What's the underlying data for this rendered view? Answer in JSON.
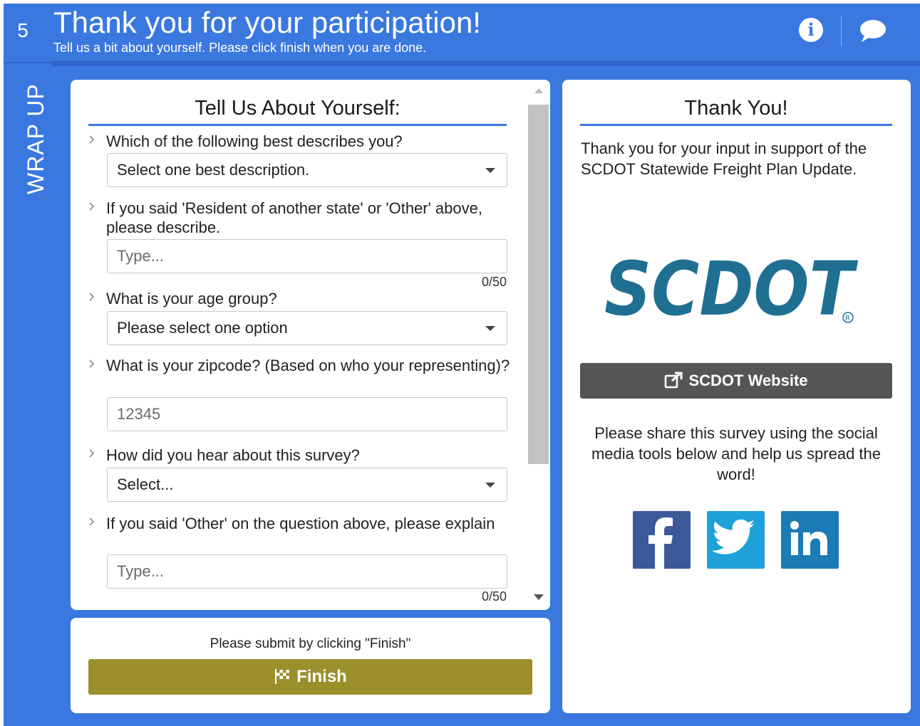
{
  "sidebar": {
    "step_number": "5",
    "section_label": "WRAP UP"
  },
  "header": {
    "title": "Thank you for your participation!",
    "subtitle": "Tell us a bit about yourself. Please click finish when you are done.",
    "info_icon": "info-icon",
    "chat_icon": "chat-bubble-icon"
  },
  "form": {
    "title": "Tell Us About Yourself:",
    "questions": [
      {
        "label": "Which of the following best describes you?",
        "type": "select",
        "value": "Select one best description."
      },
      {
        "label": "If you said 'Resident of another state' or 'Other' above, please describe.",
        "type": "text",
        "placeholder": "Type...",
        "counter": "0/50"
      },
      {
        "label": "What is your age group?",
        "type": "select",
        "value": "Please select one option"
      },
      {
        "label": "What is your zipcode? (Based on who your representing)?",
        "type": "text",
        "placeholder": "12345"
      },
      {
        "label": "How did you hear about this survey?",
        "type": "select",
        "value": "Select..."
      },
      {
        "label": "If you said 'Other' on the question above, please explain",
        "type": "text",
        "placeholder": "Type...",
        "counter": "0/50"
      }
    ]
  },
  "submit": {
    "note": "Please submit by clicking \"Finish\"",
    "finish_label": "Finish"
  },
  "thanks": {
    "title": "Thank You!",
    "message": "Thank you for your input in support of the SCDOT Statewide Freight Plan Update.",
    "logo_text": "SCDOT",
    "website_label": "SCDOT Website",
    "share_text": "Please share this survey using the social media tools below and help us spread the word!",
    "social": [
      "facebook-icon",
      "twitter-icon",
      "linkedin-icon"
    ]
  },
  "colors": {
    "brand_blue": "#3a78e0",
    "finish_olive": "#9a8f2b",
    "website_gray": "#555555",
    "logo_teal": "#1f6f93"
  }
}
